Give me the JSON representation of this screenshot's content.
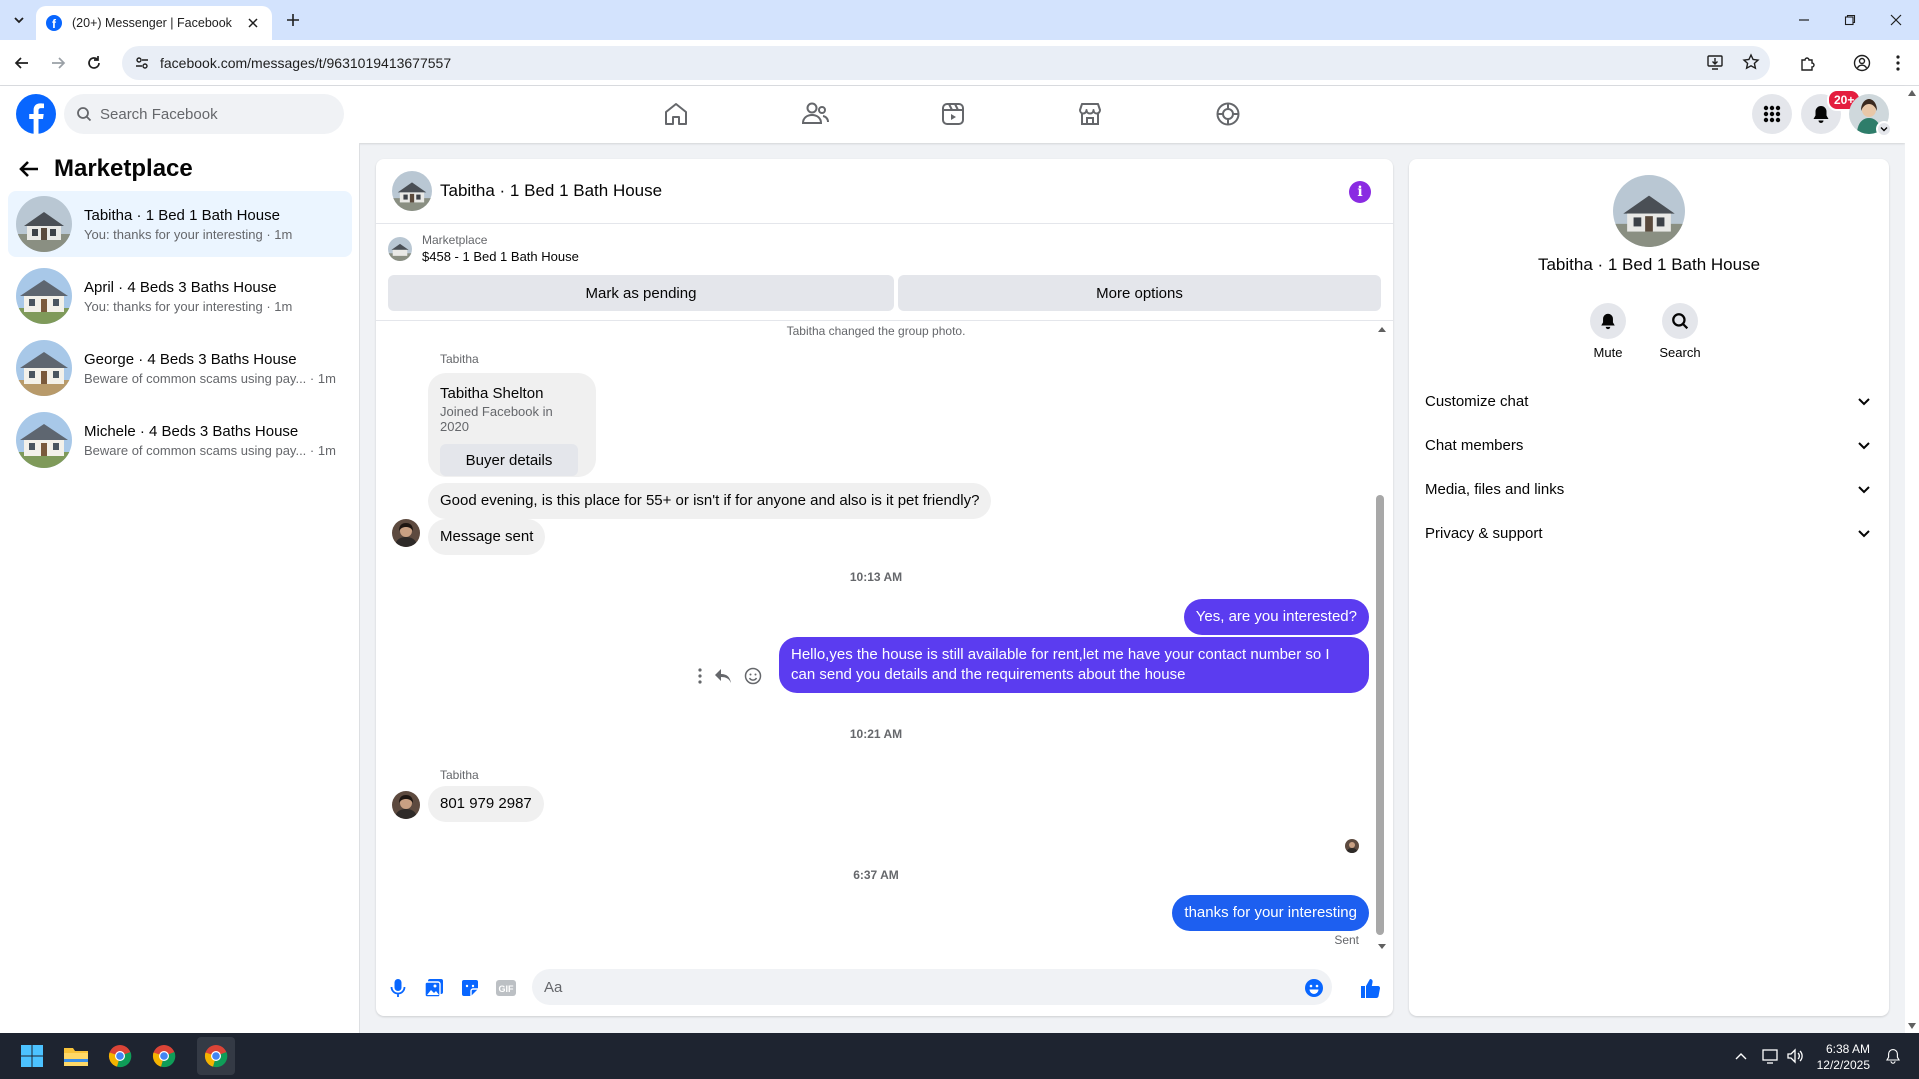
{
  "browser": {
    "tab_title": "(20+) Messenger | Facebook",
    "url": "facebook.com/messages/t/9631019413677557"
  },
  "header": {
    "search_placeholder": "Search Facebook",
    "notification_badge": "20+",
    "brand_color": "#0866ff"
  },
  "sidebar": {
    "title": "Marketplace",
    "conversations": [
      {
        "name": "Tabitha · 1 Bed 1 Bath House",
        "preview": "You: thanks for your interesting · 1m",
        "active": true
      },
      {
        "name": "April · 4 Beds 3 Baths House",
        "preview": "You: thanks for your interesting · 1m",
        "active": false
      },
      {
        "name": "George · 4 Beds 3 Baths House",
        "preview": "Beware of common scams using pay... · 1m",
        "active": false
      },
      {
        "name": "Michele · 4 Beds 3 Baths House",
        "preview": "Beware of common scams using pay... · 1m",
        "active": false
      }
    ]
  },
  "chat": {
    "title": "Tabitha · 1 Bed 1 Bath House",
    "listing": {
      "source": "Marketplace",
      "price_title": "$458 - 1 Bed 1 Bath House",
      "mark_pending": "Mark as pending",
      "more_options": "More options"
    },
    "system_note": "Tabitha changed the group photo.",
    "messages": {
      "sender1": "Tabitha",
      "card_name": "Tabitha Shelton",
      "card_sub": "Joined Facebook in 2020",
      "card_button": "Buyer details",
      "in1": "Good evening, is this place for 55+ or isn't if for anyone and also is it pet friendly?",
      "in2": "Message sent",
      "time1": "10:13 AM",
      "out1": "Yes, are you interested?",
      "out2": "Hello,yes the house is still available for rent,let me have your contact number   so I can send you details and the requirements about the house",
      "time2": "10:21 AM",
      "sender2": "Tabitha",
      "in3": "801 979 2987",
      "time3": "6:37 AM",
      "out3": "thanks for your interesting",
      "status": "Sent"
    },
    "composer_placeholder": "Aa",
    "outgoing_color": "#5b3cf0"
  },
  "details": {
    "title": "Tabitha · 1 Bed 1 Bath House",
    "actions": [
      "Mute",
      "Search"
    ],
    "sections": [
      "Customize chat",
      "Chat members",
      "Media, files and links",
      "Privacy & support"
    ]
  },
  "taskbar": {
    "time": "6:38 AM",
    "date": "12/2/2025"
  }
}
